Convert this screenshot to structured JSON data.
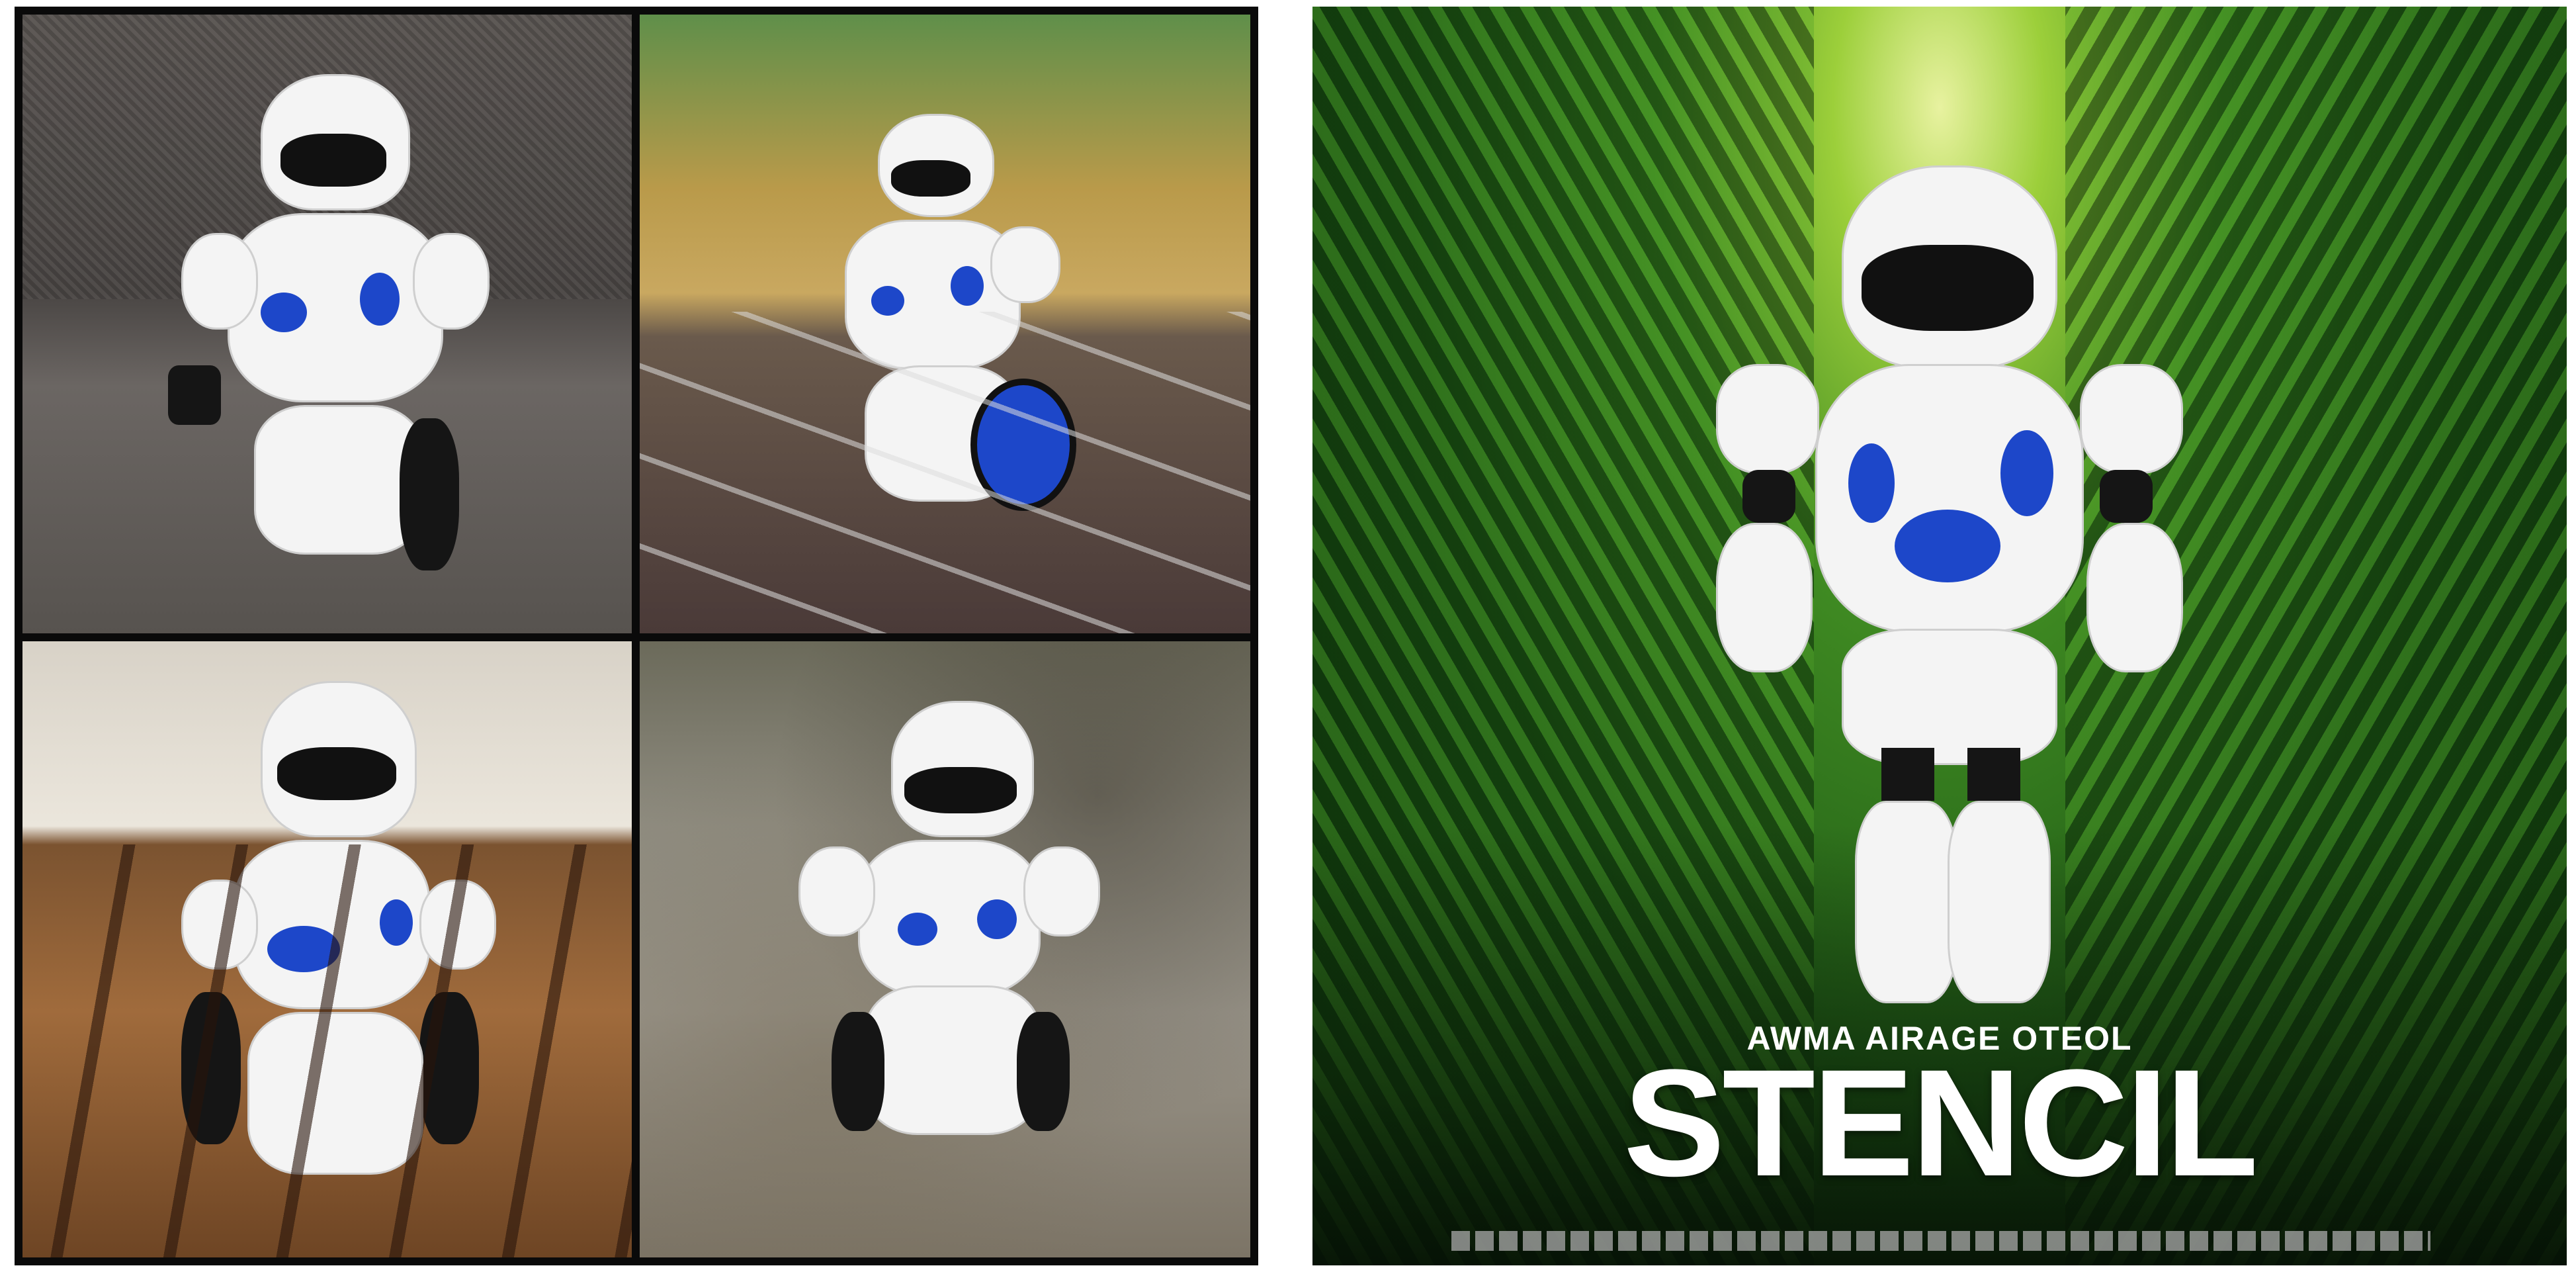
{
  "collage": {
    "photos": [
      {
        "subject": "robot-toy-on-couch"
      },
      {
        "subject": "robot-toy-on-path"
      },
      {
        "subject": "robot-toy-on-wood-slats"
      },
      {
        "subject": "robot-toy-on-rock"
      }
    ]
  },
  "poster": {
    "tagline": "AWMA AIRAGE OTEOL",
    "title": "STENCIL",
    "colors": {
      "foliage": "#2f7a1f",
      "robot_white": "#f4f4f4",
      "robot_blue": "#1d47c9",
      "title_text": "#ffffff"
    }
  }
}
